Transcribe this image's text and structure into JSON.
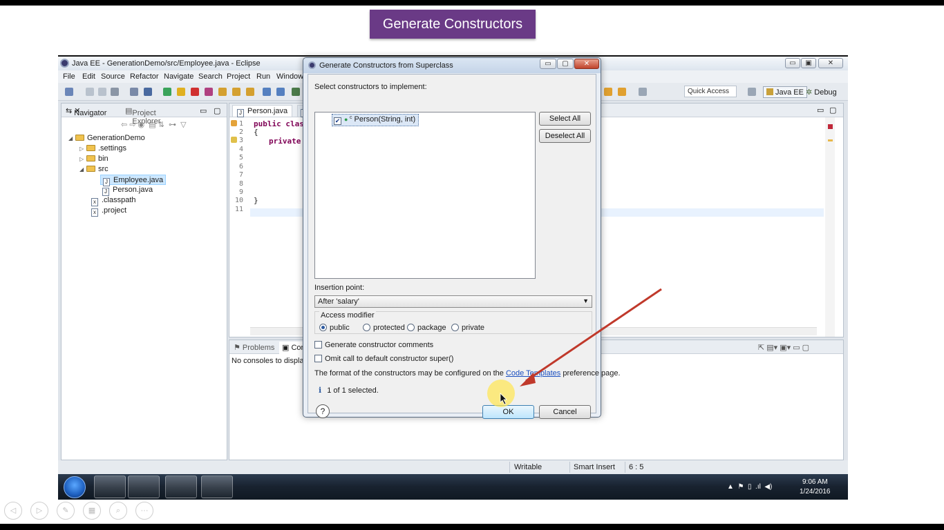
{
  "slide": {
    "title": "Generate Constructors"
  },
  "window": {
    "title": "Java EE - GenerationDemo/src/Employee.java - Eclipse"
  },
  "menu": [
    "File",
    "Edit",
    "Source",
    "Refactor",
    "Navigate",
    "Search",
    "Project",
    "Run",
    "Window"
  ],
  "toolbar": {
    "quick_access": "Quick Access",
    "perspective_javaee": "Java EE",
    "perspective_debug": "Debug"
  },
  "navigator": {
    "tab_navigator": "Navigator",
    "tab_project_explorer": "Project Explorer",
    "tree": [
      "GenerationDemo",
      ".settings",
      "bin",
      "src",
      "Employee.java",
      "Person.java",
      ".classpath",
      ".project"
    ]
  },
  "editor": {
    "tabs": [
      "Person.java"
    ],
    "line_numbers": [
      "1",
      "2",
      "3",
      "4",
      "5",
      "6",
      "7",
      "8",
      "9",
      "10",
      "11"
    ],
    "code": {
      "l1_kw": "public class",
      "l2": "{",
      "l3_kw": "private",
      "l10": "}"
    }
  },
  "console": {
    "tab_problems": "Problems",
    "tab_console": "Con",
    "message": "No consoles to display a"
  },
  "status": {
    "writable": "Writable",
    "insert_mode": "Smart Insert",
    "position": "6 : 5"
  },
  "taskbar": {
    "time": "9:06 AM",
    "date": "1/24/2016"
  },
  "dialog": {
    "title": "Generate Constructors from Superclass",
    "select_label": "Select constructors to implement:",
    "constructors": [
      {
        "label": "Person(String, int)",
        "checked": true
      }
    ],
    "select_all": "Select All",
    "deselect_all": "Deselect All",
    "insertion_label": "Insertion point:",
    "insertion_value": "After 'salary'",
    "access_label": "Access modifier",
    "access_options": [
      "public",
      "protected",
      "package",
      "private"
    ],
    "access_selected": "public",
    "gen_comments": "Generate constructor comments",
    "omit_super": "Omit call to default constructor super()",
    "info_prefix": "The format of the constructors may be configured on the",
    "info_link": "Code Templates",
    "info_suffix": "preference page.",
    "selected_count": "1 of 1 selected.",
    "ok": "OK",
    "cancel": "Cancel"
  },
  "colors": {
    "slide_title_bg": "#6a3a86",
    "arrow": "#c0392b",
    "cursor_highlight": "#ffe650"
  }
}
